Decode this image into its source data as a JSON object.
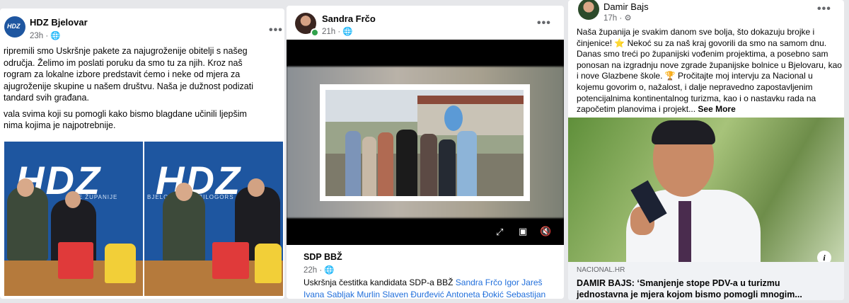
{
  "posts": [
    {
      "author": "HDZ Bjelovar",
      "time": "23h",
      "avatar_text": "HDZ",
      "more": "•••",
      "lines": [
        "ripremili smo Uskršnje pakete za najugroženije obitelji s našeg",
        "odručja. Želimo im poslati poruku da smo tu za njih. Kroz naš",
        "rogram za lokalne izbore predstavit ćemo i neke od mjera za",
        "ajugroženije skupine u našem društvu. Naša je dužnost podizati",
        "tandard svih građana.",
        "vala svima koji su pomogli kako bismo blagdane učinili ljepšim",
        "nima kojima je najpotrebnije."
      ],
      "photo_left": {
        "logo": "HDZ",
        "banner": "ŠKE ŽUPANIJE"
      },
      "photo_right": {
        "logo": "HDZ",
        "banner": "BJELOVARSKO-BILOGORS"
      }
    },
    {
      "author": "Sandra Frčo",
      "time": "21h",
      "more": "•••",
      "link_source": "SDP BBŽ",
      "link_time": "22h",
      "caption_prefix": "Uskršnja čestitka kandidata SDP-a BBŽ ",
      "tags_line1": [
        "Sandra Frčo",
        "Igor Jareš"
      ],
      "tags_line2": [
        "Ivana Sabljak Murlin",
        "Slaven Đurđević",
        "Antoneta Đokić",
        "Sebastijan"
      ],
      "controls": {
        "expand": "⤢",
        "pip": "▣",
        "mute": "🔇"
      }
    },
    {
      "author": "Damir Bajs",
      "time": "17h",
      "more": "•••",
      "text_lines": [
        "Naša županija je svakim danom sve bolja, što dokazuju brojke i",
        "činjenice! ⭐ Nekoć su za naš kraj govorili da smo na samom dnu.",
        "Danas smo treći po županijski vođenim projektima, a posebno sam",
        "ponosan na izgradnju nove zgrade županijske bolnice u Bjelovaru, kao",
        "i nove Glazbene škole. 🏆 Pročitajte moj intervju za Nacional u",
        "kojemu govorim o, nažalost, i dalje nepravedno zapostavljenim",
        "potencijalnima kontinentalnog turizma, kao i o nastavku rada na",
        "započetim planovima i projekt..."
      ],
      "see_more": "See More",
      "link_domain": "NACIONAL.HR",
      "link_title_1": "DAMIR BAJS: ‘Smanjenje stope PDV-a u turizmu",
      "link_title_2": "jednostavna je mjera kojom bismo pomogli mnogim...",
      "info_icon": "i"
    }
  ],
  "colors": {
    "link": "#216fdb",
    "meta": "#65676b",
    "hdz_blue": "#1e56a0"
  }
}
